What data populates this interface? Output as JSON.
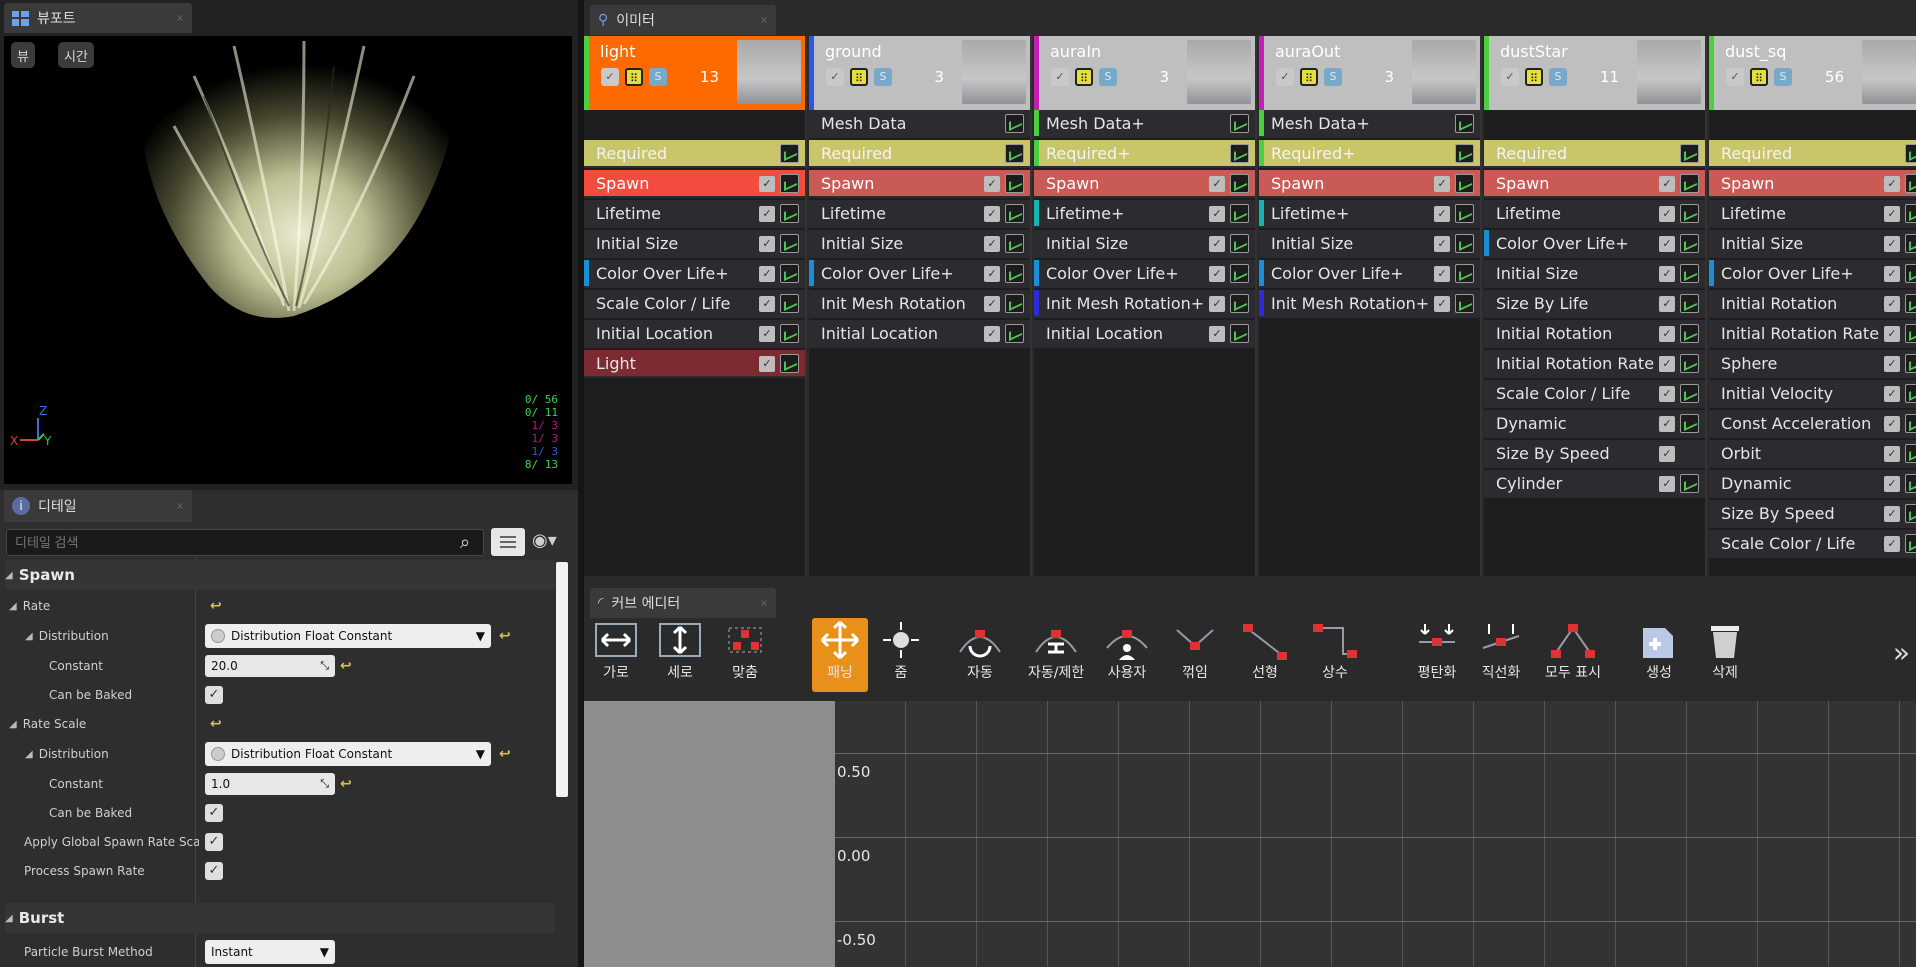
{
  "viewport": {
    "tab_title": "뷰포트",
    "btn_view": "뷰",
    "btn_time": "시간",
    "stats": [
      {
        "text": "0/ 56",
        "color": "#3fd24a"
      },
      {
        "text": "0/ 11",
        "color": "#3fd24a"
      },
      {
        "text": "1/ 3",
        "color": "#b01b8f"
      },
      {
        "text": "1/ 3",
        "color": "#b01b8f"
      },
      {
        "text": "1/ 3",
        "color": "#2b5de0"
      },
      {
        "text": "8/ 13",
        "color": "#3fd24a"
      }
    ],
    "axis_z": "Z",
    "axis_y": "Y",
    "axis_x": "X"
  },
  "details": {
    "tab_title": "디테일",
    "search_placeholder": "디테일 검색",
    "spawn_header": "Spawn",
    "rate": "Rate",
    "distribution1": "Distribution",
    "dist_value1": "Distribution Float Constant",
    "constant1": "Constant",
    "constant1_value": "20.0",
    "baked1": "Can be Baked",
    "rate_scale": "Rate Scale",
    "distribution2": "Distribution",
    "dist_value2": "Distribution Float Constant",
    "constant2": "Constant",
    "constant2_value": "1.0",
    "baked2": "Can be Baked",
    "apply_global": "Apply Global Spawn Rate Scal",
    "process_spawn": "Process Spawn Rate",
    "burst_header": "Burst",
    "burst_method": "Particle Burst Method",
    "burst_method_value": "Instant"
  },
  "emitters": {
    "tab_title": "이미터",
    "columns": [
      {
        "name": "light",
        "count": "13",
        "head_color": "#ff6a00",
        "left_bar": "#4ccf3f",
        "modules": [
          {
            "label": "Required",
            "bg": "#c9c56b",
            "fg": "#f3f3f3",
            "chk": false,
            "bar": ""
          },
          {
            "label": "Spawn",
            "bg": "#f24c3f",
            "fg": "#ffffff",
            "chk": true,
            "bar": ""
          },
          {
            "label": "Lifetime",
            "bg": "#2b2b30",
            "fg": "#e6e6e6",
            "chk": true,
            "bar": ""
          },
          {
            "label": "Initial Size",
            "bg": "#2b2b30",
            "fg": "#e6e6e6",
            "chk": true,
            "bar": ""
          },
          {
            "label": "Color Over Life+",
            "bg": "#2b2b30",
            "fg": "#e6e6e6",
            "chk": true,
            "bar": "#1a8fd8"
          },
          {
            "label": "Scale Color / Life",
            "bg": "#2b2b30",
            "fg": "#e6e6e6",
            "chk": true,
            "bar": ""
          },
          {
            "label": "Initial Location",
            "bg": "#2b2b30",
            "fg": "#e6e6e6",
            "chk": true,
            "bar": ""
          },
          {
            "label": "Light",
            "bg": "#7d2a30",
            "fg": "#e6e6e6",
            "chk": true,
            "bar": ""
          }
        ]
      },
      {
        "name": "ground",
        "count": "3",
        "head_color": "#bfbfbf",
        "left_bar": "#2f56e0",
        "modules": [
          {
            "label": "Mesh Data",
            "bg": "#2b2b30",
            "fg": "#e6e6e6",
            "chk": false,
            "bar": ""
          },
          {
            "label": "Required",
            "bg": "#c9c56b",
            "fg": "#f3f3f3",
            "chk": false,
            "bar": ""
          },
          {
            "label": "Spawn",
            "bg": "#c95a55",
            "fg": "#ffffff",
            "chk": true,
            "bar": ""
          },
          {
            "label": "Lifetime",
            "bg": "#2b2b30",
            "fg": "#e6e6e6",
            "chk": true,
            "bar": ""
          },
          {
            "label": "Initial Size",
            "bg": "#2b2b30",
            "fg": "#e6e6e6",
            "chk": true,
            "bar": ""
          },
          {
            "label": "Color Over Life+",
            "bg": "#2b2b30",
            "fg": "#e6e6e6",
            "chk": true,
            "bar": "#1a8fd8"
          },
          {
            "label": "Init Mesh Rotation",
            "bg": "#2b2b30",
            "fg": "#e6e6e6",
            "chk": true,
            "bar": ""
          },
          {
            "label": "Initial Location",
            "bg": "#2b2b30",
            "fg": "#e6e6e6",
            "chk": true,
            "bar": ""
          }
        ]
      },
      {
        "name": "auraIn",
        "count": "3",
        "head_color": "#bfbfbf",
        "left_bar": "#c51db5",
        "modules": [
          {
            "label": "Mesh Data+",
            "bg": "#2b2b30",
            "fg": "#e6e6e6",
            "chk": false,
            "bar": "#4ccf3f"
          },
          {
            "label": "Required+",
            "bg": "#c9c56b",
            "fg": "#f3f3f3",
            "chk": false,
            "bar": "#4ccf3f"
          },
          {
            "label": "Spawn",
            "bg": "#c95a55",
            "fg": "#ffffff",
            "chk": true,
            "bar": ""
          },
          {
            "label": "Lifetime+",
            "bg": "#2b2b30",
            "fg": "#e6e6e6",
            "chk": true,
            "bar": "#16b3b0"
          },
          {
            "label": "Initial Size",
            "bg": "#2b2b30",
            "fg": "#e6e6e6",
            "chk": true,
            "bar": ""
          },
          {
            "label": "Color Over Life+",
            "bg": "#2b2b30",
            "fg": "#e6e6e6",
            "chk": true,
            "bar": "#1a8fd8"
          },
          {
            "label": "Init Mesh Rotation+",
            "bg": "#2b2b30",
            "fg": "#e6e6e6",
            "chk": true,
            "bar": "#2b2bd8"
          },
          {
            "label": "Initial Location",
            "bg": "#2b2b30",
            "fg": "#e6e6e6",
            "chk": true,
            "bar": ""
          }
        ]
      },
      {
        "name": "auraOut",
        "count": "3",
        "head_color": "#bfbfbf",
        "left_bar": "#c51db5",
        "modules": [
          {
            "label": "Mesh Data+",
            "bg": "#2b2b30",
            "fg": "#e6e6e6",
            "chk": false,
            "bar": "#4ccf3f"
          },
          {
            "label": "Required+",
            "bg": "#c9c56b",
            "fg": "#f3f3f3",
            "chk": false,
            "bar": "#4ccf3f"
          },
          {
            "label": "Spawn",
            "bg": "#c95a55",
            "fg": "#ffffff",
            "chk": true,
            "bar": ""
          },
          {
            "label": "Lifetime+",
            "bg": "#2b2b30",
            "fg": "#e6e6e6",
            "chk": true,
            "bar": "#16b3b0"
          },
          {
            "label": "Initial Size",
            "bg": "#2b2b30",
            "fg": "#e6e6e6",
            "chk": true,
            "bar": ""
          },
          {
            "label": "Color Over Life+",
            "bg": "#2b2b30",
            "fg": "#e6e6e6",
            "chk": true,
            "bar": "#1a8fd8"
          },
          {
            "label": "Init Mesh Rotation+",
            "bg": "#2b2b30",
            "fg": "#e6e6e6",
            "chk": true,
            "bar": "#2b2bd8"
          }
        ]
      },
      {
        "name": "dustStar",
        "count": "11",
        "head_color": "#bfbfbf",
        "left_bar": "#4ccf3f",
        "modules": [
          {
            "label": "Required",
            "bg": "#c9c56b",
            "fg": "#f3f3f3",
            "chk": false,
            "bar": ""
          },
          {
            "label": "Spawn",
            "bg": "#c95a55",
            "fg": "#ffffff",
            "chk": true,
            "bar": ""
          },
          {
            "label": "Lifetime",
            "bg": "#2b2b30",
            "fg": "#e6e6e6",
            "chk": true,
            "bar": ""
          },
          {
            "label": "Color Over Life+",
            "bg": "#2b2b30",
            "fg": "#e6e6e6",
            "chk": true,
            "bar": "#1a8fd8"
          },
          {
            "label": "Initial Size",
            "bg": "#2b2b30",
            "fg": "#e6e6e6",
            "chk": true,
            "bar": ""
          },
          {
            "label": "Size By Life",
            "bg": "#2b2b30",
            "fg": "#e6e6e6",
            "chk": true,
            "bar": ""
          },
          {
            "label": "Initial Rotation",
            "bg": "#2b2b30",
            "fg": "#e6e6e6",
            "chk": true,
            "bar": ""
          },
          {
            "label": "Initial Rotation Rate",
            "bg": "#2b2b30",
            "fg": "#e6e6e6",
            "chk": true,
            "bar": ""
          },
          {
            "label": "Scale Color / Life",
            "bg": "#2b2b30",
            "fg": "#e6e6e6",
            "chk": true,
            "bar": ""
          },
          {
            "label": "Dynamic",
            "bg": "#2b2b30",
            "fg": "#e6e6e6",
            "chk": true,
            "bar": ""
          },
          {
            "label": "Size By Speed",
            "bg": "#2b2b30",
            "fg": "#e6e6e6",
            "chk": true,
            "bar": "",
            "nograph": true
          },
          {
            "label": "Cylinder",
            "bg": "#2b2b30",
            "fg": "#e6e6e6",
            "chk": true,
            "bar": ""
          }
        ]
      },
      {
        "name": "dust_sq",
        "count": "56",
        "head_color": "#bfbfbf",
        "left_bar": "#4ccf3f",
        "modules": [
          {
            "label": "Required",
            "bg": "#c9c56b",
            "fg": "#f3f3f3",
            "chk": false,
            "bar": ""
          },
          {
            "label": "Spawn",
            "bg": "#c95a55",
            "fg": "#ffffff",
            "chk": true,
            "bar": ""
          },
          {
            "label": "Lifetime",
            "bg": "#2b2b30",
            "fg": "#e6e6e6",
            "chk": true,
            "bar": ""
          },
          {
            "label": "Initial Size",
            "bg": "#2b2b30",
            "fg": "#e6e6e6",
            "chk": true,
            "bar": ""
          },
          {
            "label": "Color Over Life+",
            "bg": "#2b2b30",
            "fg": "#e6e6e6",
            "chk": true,
            "bar": "#1a8fd8"
          },
          {
            "label": "Initial Rotation",
            "bg": "#2b2b30",
            "fg": "#e6e6e6",
            "chk": true,
            "bar": ""
          },
          {
            "label": "Initial Rotation Rate",
            "bg": "#2b2b30",
            "fg": "#e6e6e6",
            "chk": true,
            "bar": ""
          },
          {
            "label": "Sphere",
            "bg": "#2b2b30",
            "fg": "#e6e6e6",
            "chk": true,
            "bar": ""
          },
          {
            "label": "Initial Velocity",
            "bg": "#2b2b30",
            "fg": "#e6e6e6",
            "chk": true,
            "bar": ""
          },
          {
            "label": "Const Acceleration",
            "bg": "#2b2b30",
            "fg": "#e6e6e6",
            "chk": true,
            "bar": ""
          },
          {
            "label": "Orbit",
            "bg": "#2b2b30",
            "fg": "#e6e6e6",
            "chk": true,
            "bar": ""
          },
          {
            "label": "Dynamic",
            "bg": "#2b2b30",
            "fg": "#e6e6e6",
            "chk": true,
            "bar": ""
          },
          {
            "label": "Size By Speed",
            "bg": "#2b2b30",
            "fg": "#e6e6e6",
            "chk": true,
            "bar": ""
          },
          {
            "label": "Scale Color / Life",
            "bg": "#2b2b30",
            "fg": "#e6e6e6",
            "chk": true,
            "bar": ""
          }
        ]
      }
    ]
  },
  "curve_editor": {
    "tab_title": "커브 에디터",
    "toolbar": [
      {
        "label": "가로",
        "icon": "horizontal-fit-icon"
      },
      {
        "label": "세로",
        "icon": "vertical-fit-icon"
      },
      {
        "label": "맞춤",
        "icon": "fit-icon"
      },
      {
        "label": "패닝",
        "icon": "pan-icon",
        "active": true
      },
      {
        "label": "줌",
        "icon": "zoom-icon"
      },
      {
        "label": "자동",
        "icon": "auto-tangent-icon"
      },
      {
        "label": "자동/제한",
        "icon": "auto-clamped-icon"
      },
      {
        "label": "사용자",
        "icon": "user-tangent-icon"
      },
      {
        "label": "꺾임",
        "icon": "break-tangent-icon"
      },
      {
        "label": "선형",
        "icon": "linear-icon"
      },
      {
        "label": "상수",
        "icon": "constant-icon"
      },
      {
        "label": "평탄화",
        "icon": "flatten-icon"
      },
      {
        "label": "직선화",
        "icon": "straighten-icon"
      },
      {
        "label": "모두 표시",
        "icon": "show-all-icon"
      },
      {
        "label": "생성",
        "icon": "create-icon"
      },
      {
        "label": "삭제",
        "icon": "delete-icon"
      }
    ],
    "more": "»",
    "y_labels": [
      "0.50",
      "0.00",
      "-0.50"
    ]
  }
}
